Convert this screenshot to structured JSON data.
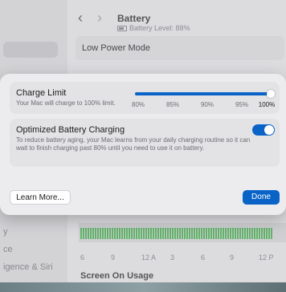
{
  "background": {
    "title": "Battery",
    "subtitle": "Battery Level: 88%",
    "low_power_label": "Low Power Mode",
    "sidebar_items": [
      "y",
      "ce",
      "igence & Siri"
    ],
    "chart_ticks": [
      "6",
      "9",
      "12 A",
      "3",
      "6",
      "9",
      "12 P"
    ],
    "section_title": "Screen On Usage"
  },
  "charge_limit": {
    "title": "Charge Limit",
    "subtitle": "Your Mac will charge to 100% limit.",
    "ticks": [
      "80%",
      "85%",
      "90%",
      "95%",
      "100%"
    ],
    "value_percent": 100
  },
  "optimized": {
    "title": "Optimized Battery Charging",
    "description": "To reduce battery aging, your Mac learns from your daily charging routine so it can wait to finish charging past 80% until you need to use it on battery.",
    "enabled": true
  },
  "buttons": {
    "learn_more": "Learn More...",
    "done": "Done"
  },
  "colors": {
    "accent": "#0a64c8"
  }
}
